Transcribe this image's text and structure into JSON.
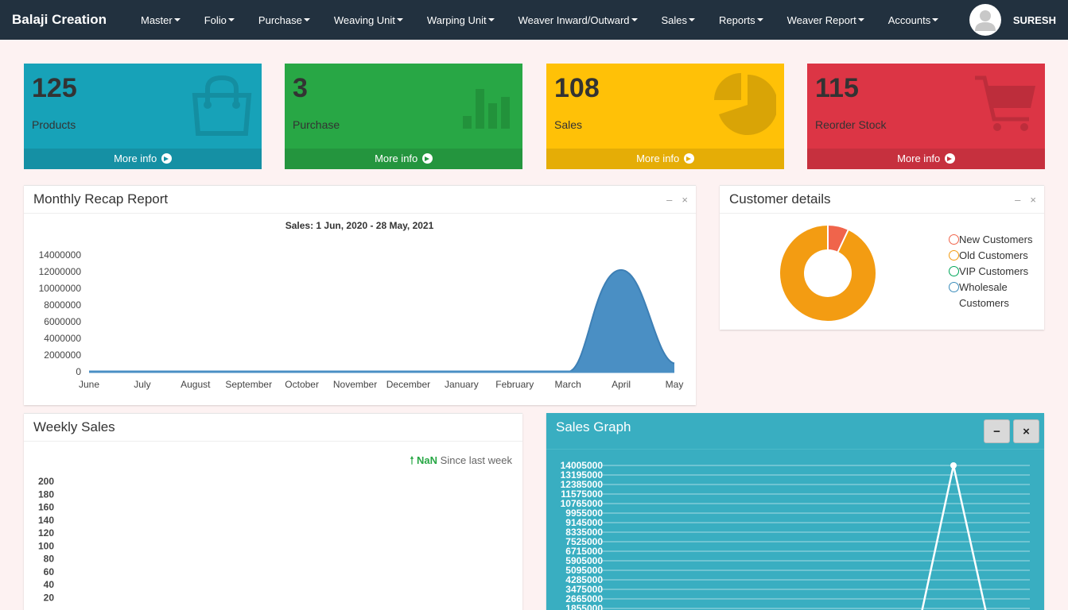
{
  "navbar": {
    "brand": "Balaji Creation",
    "items": [
      "Master",
      "Folio",
      "Purchase",
      "Weaving Unit",
      "Warping Unit",
      "Weaver Inward/Outward",
      "Sales",
      "Reports",
      "Weaver Report",
      "Accounts"
    ],
    "username": "SURESH"
  },
  "stats": [
    {
      "value": "125",
      "label": "Products",
      "more": "More info",
      "icon": "shopping-bag-icon",
      "color": "#17a2b8",
      "foot": "#1590a4",
      "icon_color": "#148ea1"
    },
    {
      "value": "3",
      "label": "Purchase",
      "more": "More info",
      "icon": "bar-chart-icon",
      "color": "#28a745",
      "foot": "#24953e",
      "icon_color": "#22923b"
    },
    {
      "value": "108",
      "label": "Sales",
      "more": "More info",
      "icon": "pie-chart-icon",
      "color": "#ffc107",
      "foot": "#e5ad06",
      "icon_color": "#d9a406"
    },
    {
      "value": "115",
      "label": "Reorder Stock",
      "more": "More info",
      "icon": "cart-icon",
      "color": "#dc3545",
      "foot": "#c6303e",
      "icon_color": "#bd2d3b"
    }
  ],
  "monthly": {
    "title": "Monthly Recap Report",
    "chart_data": {
      "type": "area",
      "title": "Sales: 1 Jun, 2020 - 28 May, 2021",
      "categories": [
        "June",
        "July",
        "August",
        "September",
        "October",
        "November",
        "December",
        "January",
        "February",
        "March",
        "April",
        "May"
      ],
      "values": [
        0,
        0,
        0,
        0,
        0,
        0,
        0,
        0,
        0,
        0,
        12200000,
        1000000
      ],
      "yticks": [
        0,
        2000000,
        4000000,
        6000000,
        8000000,
        10000000,
        12000000,
        14000000
      ],
      "ylim": [
        0,
        14000000
      ],
      "color": "#4a8fc4"
    }
  },
  "customer": {
    "title": "Customer details",
    "chart_data": {
      "type": "pie",
      "labels": [
        "New Customers",
        "Old Customers",
        "VIP Customers",
        "Wholesale Customers"
      ],
      "values": [
        7,
        93,
        0,
        0
      ],
      "colors": [
        "#f0644b",
        "#f39c12",
        "#00a65a",
        "#3c8dbc"
      ]
    }
  },
  "weekly": {
    "title": "Weekly Sales",
    "change_value": "NaN",
    "change_text": "Since last week",
    "chart_data": {
      "type": "bar",
      "yticks": [
        20,
        40,
        60,
        80,
        100,
        120,
        140,
        160,
        180,
        200
      ],
      "ylim": [
        0,
        200
      ]
    }
  },
  "sales_graph": {
    "title": "Sales Graph",
    "minimize": "−",
    "close": "×",
    "chart_data": {
      "type": "line",
      "yticks": [
        1855000,
        2665000,
        3475000,
        4285000,
        5095000,
        5905000,
        6715000,
        7525000,
        8335000,
        9145000,
        9955000,
        10765000,
        11575000,
        12385000,
        13195000,
        14005000
      ],
      "peak_value": 14005000
    }
  }
}
